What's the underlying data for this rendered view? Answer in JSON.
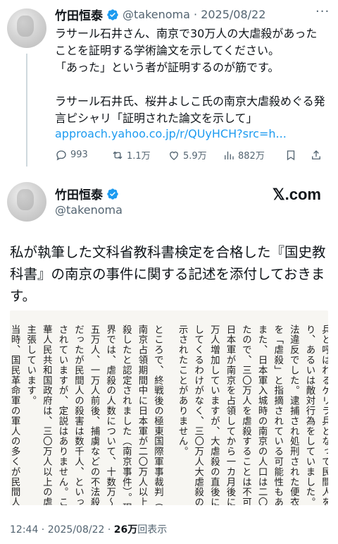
{
  "tweet1": {
    "name": "竹田恒泰",
    "handle_date": "@takenoma · 2025/08/22",
    "text": "ラサール石井さん、南京で30万人の大虐殺があったことを証明する学術論文を示してください。\n「あった」という者が証明するのが筋です。",
    "quote_title": "ラサール石井氏、桜井よしこ氏の南京大虐殺めぐる発言ピシャリ「証明された論文を示して」",
    "link": "approach.yahoo.co.jp/r/QUyHCH?src=h...",
    "replies": "993",
    "retweets": "1.1万",
    "likes": "5.9万",
    "views": "882万"
  },
  "tweet2": {
    "name": "竹田恒泰",
    "handle": "@takenoma",
    "site": "𝕏.com",
    "text": "私が執筆した文科省教科書検定を合格した『国史教科書』の南京の事件に関する記述を添付しておきます。",
    "doc_columns": [
      "兵と呼ばれるゲリラ兵となって民間人を人質に",
      "り、あるいは敵対行為をしていました。これは",
      "法違反でした。逮捕され処刑された便衣兵も多く",
      "を「虐殺」と指摘されている可能性もあります",
      "また、日本軍入城時の南京の人口は二〇万人程度",
      "たので、三〇万人を虐殺することは不可能です。",
      "日本軍が南京を占領してから一カ月後には人口",
      "万人増加していますが、大虐殺の直後に五万人",
      "してくるわけがなく、三〇万人大虐殺の根拠は",
      "示されたことがありません。",
      "ところで、終戦後の極東国際軍事裁判（東京裁判",
      "南京占領期間中に日本軍が二〇万人以上の住民",
      "殺したと認定されました（南京事件）。現在の日本",
      "界では、虐殺の人数について、十数万〜二〇万人",
      "五万人、一万人前後、捕虜などの不法殺害は一万",
      "だったが民間人の殺害は数千人、といった学説",
      "されていますが、定説はありません。これに対し",
      "華人民共和国政府は、三〇万人以上の虐殺があっ",
      "主張しています。",
      "当時、国民革命軍の軍人の多くが民間人に扮し"
    ],
    "timestamp": "12:44 · 2025/08/22 · ",
    "views_count": "26万",
    "views_label": "回表示"
  }
}
